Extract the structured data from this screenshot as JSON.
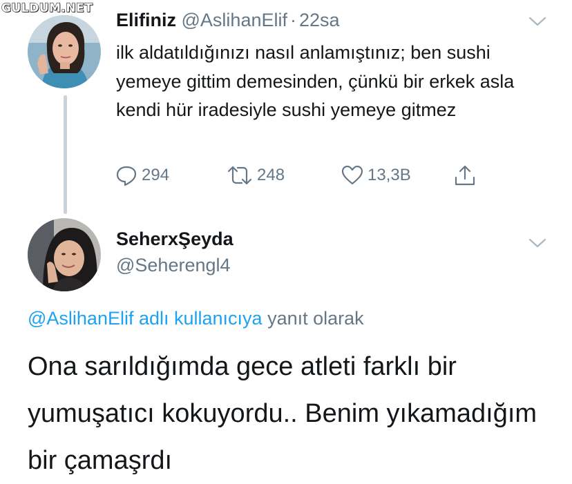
{
  "watermark": "GULDUM.NET",
  "tweet1": {
    "name": "Elifiniz",
    "handle": "@AslihanElif",
    "separator": "·",
    "time": "22sa",
    "text": "ilk aldatıldığınızı nasıl anlamıştınız; ben sushi yemeye gittim demesinden, çünkü bir erkek asla kendi hür iradesiyle sushi yemeye gitmez",
    "actions": {
      "replies": "294",
      "retweets": "248",
      "likes": "13,3B"
    },
    "icons": [
      "reply-icon",
      "retweet-icon",
      "like-icon",
      "share-icon",
      "chevron-down-icon"
    ]
  },
  "tweet2": {
    "name": "SeherxŞeyda",
    "handle": "@Seherengl4",
    "reply_to_link": "@AslihanElif adlı kullanıcıya",
    "reply_to_rest": "yanıt olarak",
    "text": "Ona sarıldığımda gece atleti farklı bir yumuşatıcı kokuyordu.. Benim yıkamadığım bir çamaşrdı"
  },
  "colors": {
    "primary_text": "#14171a",
    "secondary_text": "#657786",
    "link": "#1da1f2",
    "thread_line": "#c9d1d9"
  }
}
